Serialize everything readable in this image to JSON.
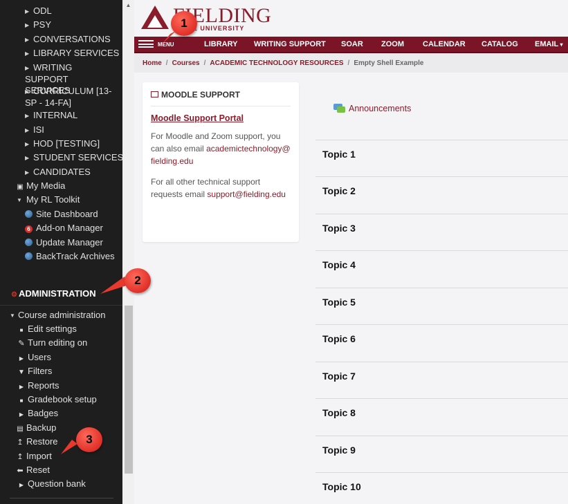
{
  "sidebar": {
    "top_items": [
      {
        "label": "ODL"
      },
      {
        "label": "PSY"
      },
      {
        "label": "CONVERSATIONS"
      },
      {
        "label": "LIBRARY SERVICES"
      },
      {
        "label": "WRITING SUPPORT SERVICES"
      },
      {
        "label": "CURRICULUM [13-SP - 14-FA]"
      },
      {
        "label": "INTERNAL"
      },
      {
        "label": "ISI"
      },
      {
        "label": "HOD [TESTING]"
      },
      {
        "label": "STUDENT SERVICES"
      },
      {
        "label": "CANDIDATES"
      }
    ],
    "my_media": "My Media",
    "rl_toolkit": {
      "label": "My RL Toolkit",
      "items": [
        {
          "label": "Site Dashboard",
          "icon": "globe-icon"
        },
        {
          "label": "Add-on Manager",
          "icon": "addon-badge-icon",
          "badge": "6"
        },
        {
          "label": "Update Manager",
          "icon": "globe-icon"
        },
        {
          "label": "BackTrack Archives",
          "icon": "globe-icon"
        }
      ]
    },
    "administration": {
      "header": "ADMINISTRATION",
      "course_admin": "Course administration",
      "items": [
        {
          "label": "Edit settings",
          "icon": "square-bullet"
        },
        {
          "label": "Turn editing on",
          "icon": "pencil-icon"
        },
        {
          "label": "Users",
          "icon": "triangle-right"
        },
        {
          "label": "Filters",
          "icon": "filter-icon"
        },
        {
          "label": "Reports",
          "icon": "triangle-right"
        },
        {
          "label": "Gradebook setup",
          "icon": "square-bullet"
        },
        {
          "label": "Badges",
          "icon": "triangle-right"
        }
      ],
      "items2": [
        {
          "label": "Backup",
          "icon": "backup-icon"
        },
        {
          "label": "Restore",
          "icon": "upload-icon"
        },
        {
          "label": "Import",
          "icon": "upload-icon"
        },
        {
          "label": "Reset",
          "icon": "left-arrow-icon"
        },
        {
          "label": "Question bank",
          "icon": "triangle-right"
        }
      ]
    }
  },
  "logo": {
    "name": "FIELDING",
    "sub": "UATE UNIVERSITY"
  },
  "topnav": {
    "menu": "MENU",
    "items": [
      "LIBRARY",
      "WRITING SUPPORT",
      "SOAR",
      "ZOOM",
      "CALENDAR",
      "CATALOG",
      "EMAIL"
    ]
  },
  "breadcrumb": {
    "items": [
      "Home",
      "Courses",
      "ACADEMIC TECHNOLOGY RESOURCES"
    ],
    "current": "Empty Shell Example"
  },
  "support": {
    "title": "MOODLE SUPPORT",
    "portal": "Moodle Support Portal",
    "p1_text": "For Moodle and Zoom support, you can also email",
    "p1_email": "academictechnology@fielding.edu",
    "p2_text": "For all other technical support requests email",
    "p2_email": "support@fielding.edu"
  },
  "course": {
    "announcements": "Announcements",
    "topics": [
      "Topic 1",
      "Topic 2",
      "Topic 3",
      "Topic 4",
      "Topic 5",
      "Topic 6",
      "Topic 7",
      "Topic 8",
      "Topic 9",
      "Topic 10"
    ]
  },
  "callouts": [
    "1",
    "2",
    "3"
  ],
  "colors": {
    "brand": "#7a1426",
    "link": "#8a1c2b",
    "sidebar_bg": "#1e1e1e",
    "callout": "#e8392f"
  }
}
